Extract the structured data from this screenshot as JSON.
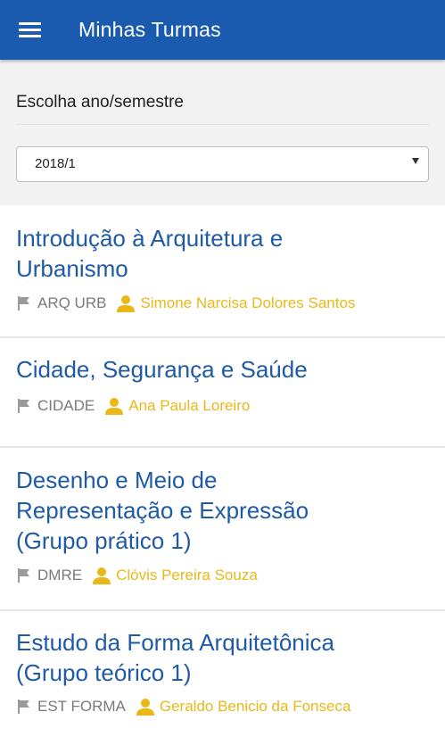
{
  "header": {
    "title": "Minhas Turmas",
    "menu_icon": "hamburger-menu-icon",
    "background": "#1a5bb0"
  },
  "filter": {
    "label": "Escolha ano/semestre",
    "selected": "2018/1"
  },
  "courses": [
    {
      "title_line1": "Introdução à Arquitetura e",
      "title_line2": "Urbanismo",
      "title_line3": "",
      "code": "ARQ URB",
      "teacher": "Simone Narcisa Dolores Santos"
    },
    {
      "title_line1": "Cidade, Segurança e Saúde",
      "title_line2": "",
      "title_line3": "",
      "code": "CIDADE",
      "teacher": "Ana Paula Loreiro"
    },
    {
      "title_line1": "Desenho e Meio de",
      "title_line2": "Representação e Expressão",
      "title_line3": "(Grupo prático 1)",
      "code": "DMRE",
      "teacher": "Clóvis Pereira Souza"
    },
    {
      "title_line1": "Estudo da Forma Arquitetônica",
      "title_line2": "(Grupo teórico 1)",
      "title_line3": "",
      "code": "EST FORMA",
      "teacher": "Geraldo Benicio da Fonseca"
    }
  ],
  "colors": {
    "title": "#1f5aa6",
    "teacher": "#e9b818",
    "code": "#7a7a7a"
  }
}
